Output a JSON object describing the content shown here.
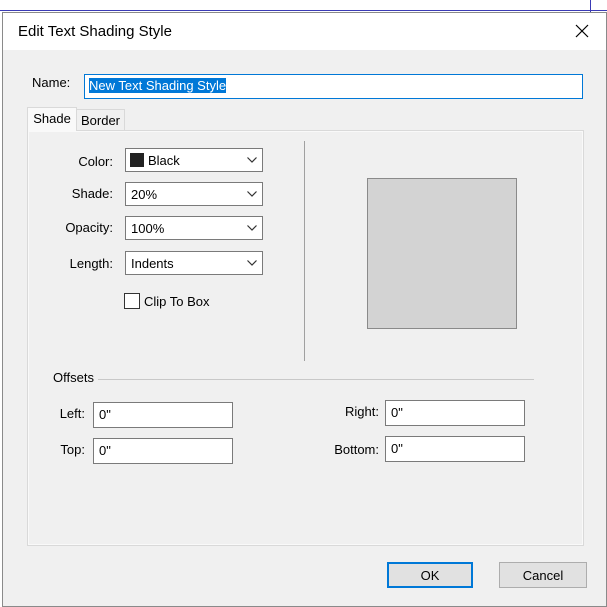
{
  "window": {
    "title": "Edit Text Shading Style",
    "close_icon": "close-icon"
  },
  "name_field": {
    "label": "Name:",
    "value": "New Text Shading Style"
  },
  "tabs": [
    {
      "label": "Shade",
      "active": true
    },
    {
      "label": "Border",
      "active": false
    }
  ],
  "shade": {
    "color": {
      "label": "Color:",
      "value": "Black",
      "swatch": "#222222"
    },
    "shade": {
      "label": "Shade:",
      "value": "20%"
    },
    "opacity": {
      "label": "Opacity:",
      "value": "100%"
    },
    "length": {
      "label": "Length:",
      "value": "Indents"
    },
    "clip_to_box": {
      "label": "Clip To Box",
      "checked": false
    }
  },
  "preview": {
    "fill": "#d3d3d3"
  },
  "offsets": {
    "group_label": "Offsets",
    "left": {
      "label": "Left:",
      "value": "0\""
    },
    "top": {
      "label": "Top:",
      "value": "0\""
    },
    "right": {
      "label": "Right:",
      "value": "0\""
    },
    "bottom": {
      "label": "Bottom:",
      "value": "0\""
    }
  },
  "buttons": {
    "ok": "OK",
    "cancel": "Cancel"
  },
  "colors": {
    "accent": "#0078d7",
    "dialog_bg": "#f0f0f0"
  }
}
